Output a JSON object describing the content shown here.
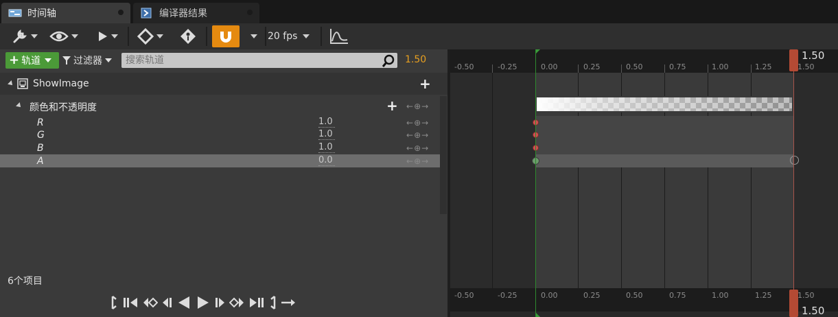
{
  "tabs": [
    {
      "label": "时间轴",
      "active": true,
      "icon": "timeline-icon"
    },
    {
      "label": "编译器结果",
      "active": false,
      "icon": "compiler-icon"
    }
  ],
  "toolbar": {
    "fps_label": "20 fps",
    "snap_color": "#e58a10"
  },
  "left": {
    "add_track_label": "轨道",
    "filter_label": "过滤器",
    "search_placeholder": "搜索轨道",
    "current_time": "1.50",
    "object_track": "ShowImage",
    "section_track": "颜色和不透明度",
    "channels": [
      {
        "name": "R",
        "value": "1.0"
      },
      {
        "name": "G",
        "value": "1.0"
      },
      {
        "name": "B",
        "value": "1.0"
      },
      {
        "name": "A",
        "value": "0.0"
      }
    ],
    "item_count": "6个项目"
  },
  "timeline": {
    "ticks": [
      "-0.50",
      "-0.25",
      "0.00",
      "0.25",
      "0.50",
      "0.75",
      "1.00",
      "1.25",
      "1.50"
    ],
    "playhead_label": "1.50",
    "start_color": "#2e8b2e",
    "end_color": "#a8544b",
    "playhead_color": "#b44a34"
  }
}
